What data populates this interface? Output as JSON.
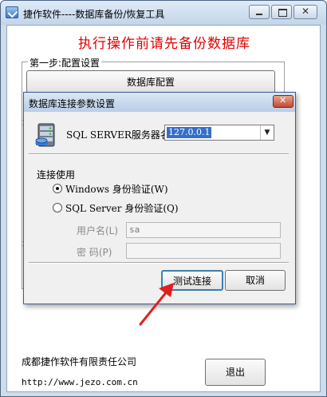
{
  "main_window": {
    "title": "捷作软件----数据库备份/恢复工具",
    "warning": "执行操作前请先备份数据库",
    "step1_label": "第一步:配置设置",
    "db_config_button": "数据库配置",
    "company": "成都捷作软件有限责任公司",
    "url": "http://www.jezo.com.cn",
    "exit_button": "退出"
  },
  "dialog": {
    "title": "数据库连接参数设置",
    "server_label": "SQL SERVER服务器名称",
    "server_value": "127.0.0.1",
    "connection_label": "连接使用",
    "auth_windows_label": "Windows 身份验证(W)",
    "auth_sql_label": "SQL Server 身份验证(Q)",
    "auth_selected": "windows",
    "username_label": "用户名(L)",
    "username_value": "sa",
    "password_label": "密  码(P)",
    "password_value": "",
    "test_button": "测试连接",
    "cancel_button": "取消"
  },
  "icons": {
    "app": "app-icon",
    "database": "database-server-icon",
    "annotation": "red-arrow-icon"
  },
  "colors": {
    "warning": "#e00000",
    "arrow": "#e02020",
    "selection": "#3470c9"
  }
}
